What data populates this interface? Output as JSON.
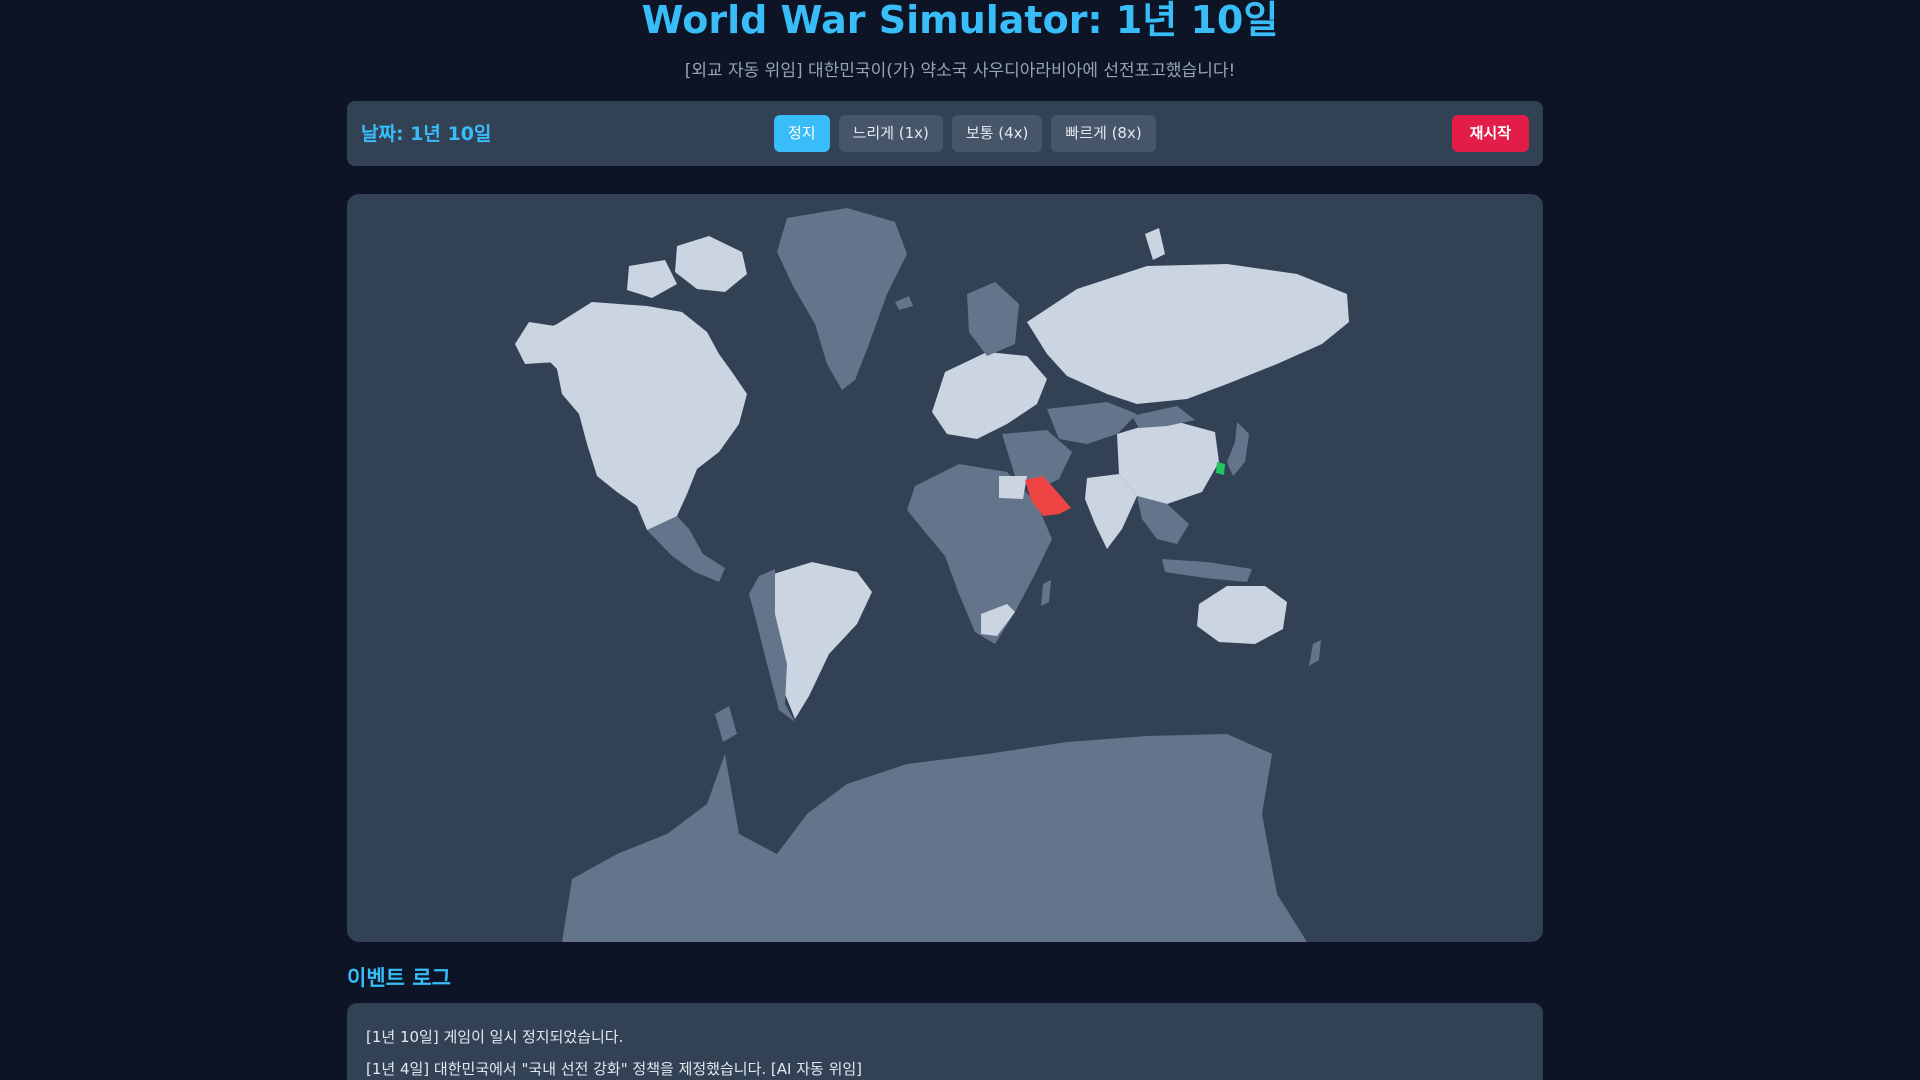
{
  "header": {
    "title": "World War Simulator: 1년 10일",
    "subtitle": "[외교 자동 위임] 대한민국이(가) 약소국 사우디아라비아에 선전포고했습니다!"
  },
  "controls": {
    "date_label": "날짜: 1년 10일",
    "speed_buttons": [
      {
        "label": "정지",
        "active": true
      },
      {
        "label": "느리게 (1x)",
        "active": false
      },
      {
        "label": "보통 (4x)",
        "active": false
      },
      {
        "label": "빠르게 (8x)",
        "active": false
      }
    ],
    "restart_label": "재시작"
  },
  "map": {
    "ocean_color": "#334155",
    "neutral_color": "#64748b",
    "allied_color": "#cbd5e1",
    "player_color": "#22c55e",
    "enemy_color": "#ef4444",
    "player_country": "대한민국",
    "enemy_country": "사우디아라비아"
  },
  "event_log": {
    "heading": "이벤트 로그",
    "entries": [
      "[1년 10일] 게임이 일시 정지되었습니다.",
      "[1년 4일] 대한민국에서 \"국내 선전 강화\" 정책을 제정했습니다. [AI 자동 위임]"
    ]
  }
}
